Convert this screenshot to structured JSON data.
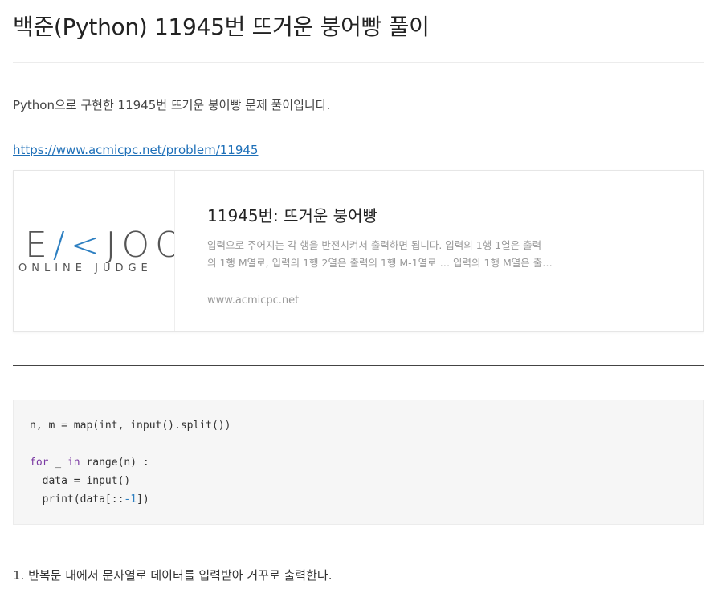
{
  "post": {
    "title": "백준(Python) 11945번 뜨거운 붕어빵 풀이",
    "intro": "Python으로 구현한 11945번 뜨거운 붕어빵 문제 풀이입니다.",
    "link": "https://www.acmicpc.net/problem/11945"
  },
  "og_card": {
    "logo_main_left": "E",
    "logo_main_accent": "/<",
    "logo_main_right": "JOO",
    "logo_sub": "ONLINE JUDGE",
    "title": "11945번: 뜨거운 붕어빵",
    "description_line1": "입력으로 주어지는 각 행을 반전시켜서 출력하면 됩니다. 입력의 1행 1열은 출력",
    "description_line2": "의 1행 M열로, 입력의 1행 2열은 출력의 1행 M-1열로 … 입력의 1행 M열은 출…",
    "url": "www.acmicpc.net"
  },
  "code": {
    "line1": "n, m = map(int, input().split())",
    "line3_kw_for": "for",
    "line3_mid": " _ ",
    "line3_kw_in": "in",
    "line3_rest": " range(n) :",
    "line4": "  data = input()",
    "line5_pre": "  print(data[::",
    "line5_num": "-1",
    "line5_post": "])"
  },
  "steps": [
    "1. 반복문 내에서 문자열로 데이터를 입력받아 거꾸로 출력한다."
  ],
  "colors": {
    "link": "#1d6fb8",
    "keyword": "#7b3aa3",
    "number": "#2d7fc1",
    "code_bg": "#f6f6f6"
  }
}
